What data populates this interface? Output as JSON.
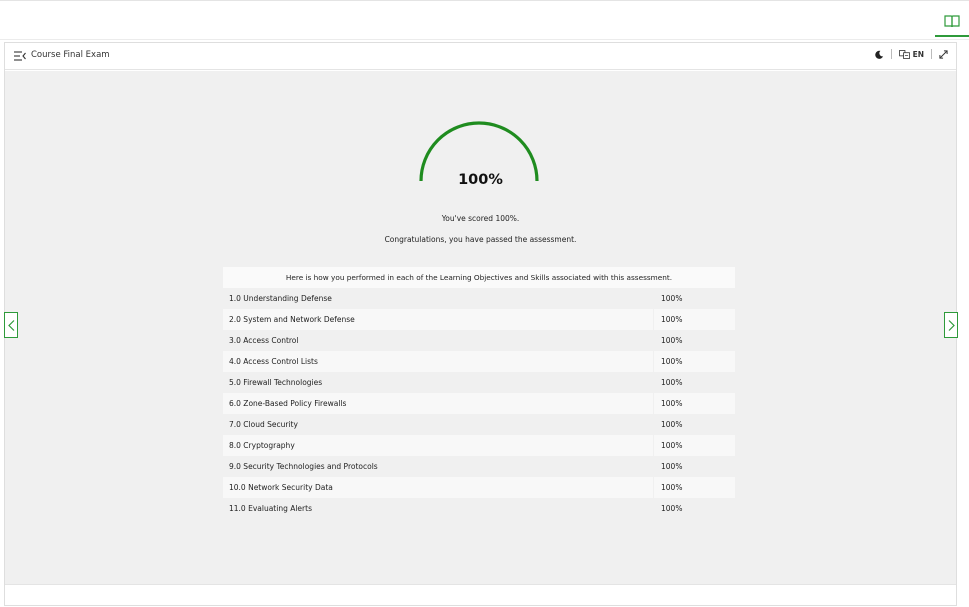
{
  "header": {
    "course_title": "Course Final Exam",
    "language": "EN",
    "icons": [
      "menu-collapse-icon",
      "moon-icon",
      "translate-icon",
      "expand-icon",
      "book-icon"
    ]
  },
  "result": {
    "score": "100%",
    "score_value": 100,
    "scored_text": "You've scored 100%.",
    "congrats_text": "Congratulations, you have passed the assessment.",
    "table_header": "Here is how you performed in each of the Learning Objectives and Skills associated with this assessment.",
    "objectives": [
      {
        "name": "1.0 Understanding Defense",
        "score": "100%"
      },
      {
        "name": "2.0 System and Network Defense",
        "score": "100%"
      },
      {
        "name": "3.0 Access Control",
        "score": "100%"
      },
      {
        "name": "4.0 Access Control Lists",
        "score": "100%"
      },
      {
        "name": "5.0 Firewall Technologies",
        "score": "100%"
      },
      {
        "name": "6.0 Zone-Based Policy Firewalls",
        "score": "100%"
      },
      {
        "name": "7.0 Cloud Security",
        "score": "100%"
      },
      {
        "name": "8.0 Cryptography",
        "score": "100%"
      },
      {
        "name": "9.0 Security Technologies and Protocols",
        "score": "100%"
      },
      {
        "name": "10.0 Network Security Data",
        "score": "100%"
      },
      {
        "name": "11.0 Evaluating Alerts",
        "score": "100%"
      }
    ]
  },
  "colors": {
    "accent": "#2e9a3a",
    "gauge": "#1f8c1f",
    "content_bg": "#f0f0f0"
  }
}
